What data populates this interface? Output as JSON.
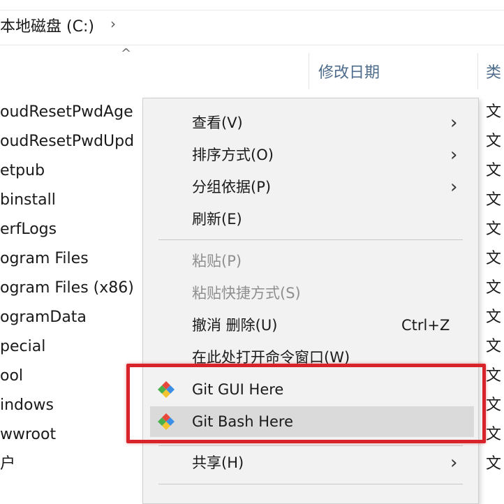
{
  "address_bar": {
    "path": "本地磁盘 (C:)",
    "chevron": "›"
  },
  "columns": {
    "sort_caret": "^",
    "date": "修改日期",
    "type": "类"
  },
  "files": [
    "oudResetPwdAge",
    "oudResetPwdUpd",
    "etpub",
    "binstall",
    "erfLogs",
    "ogram Files",
    "ogram Files (x86)",
    "ogramData",
    "pecial",
    "ool",
    "indows",
    "wwroot",
    "户"
  ],
  "type_cells": [
    "文",
    "文",
    "文",
    "文",
    "文",
    "文",
    "文",
    "文",
    "文",
    "文",
    "文",
    "文",
    "文"
  ],
  "context_menu": {
    "view": {
      "label": "查看(V)",
      "arrow": "›"
    },
    "sort_by": {
      "label": "排序方式(O)",
      "arrow": "›"
    },
    "group_by": {
      "label": "分组依据(P)",
      "arrow": "›"
    },
    "refresh": {
      "label": "刷新(E)"
    },
    "paste": {
      "label": "粘贴(P)"
    },
    "paste_shortcut": {
      "label": "粘贴快捷方式(S)"
    },
    "undo_delete": {
      "label": "撤消 删除(U)",
      "shortcut": "Ctrl+Z"
    },
    "open_cmd": {
      "label": "在此处打开命令窗口(W)"
    },
    "git_gui": {
      "label": "Git GUI Here"
    },
    "git_bash": {
      "label": "Git Bash Here"
    },
    "share": {
      "label": "共享(H)",
      "arrow": "›"
    }
  },
  "colors": {
    "highlight": "#d9232a",
    "menu_bg": "#f2f2f2",
    "hover": "#dadada",
    "header_text": "#4d6b8a"
  },
  "icons": {
    "git": "git-diamond-icon",
    "chevron": "chevron-right-icon"
  }
}
